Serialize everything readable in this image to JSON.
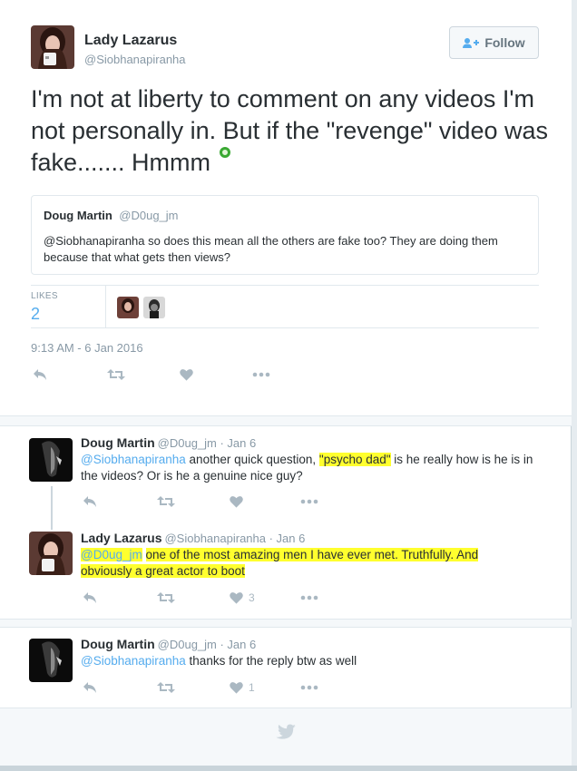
{
  "main_tweet": {
    "author_name": "Lady Lazarus",
    "author_handle": "@Siobhanapiranha",
    "follow_label": "Follow",
    "text": "I'm not at liberty to comment on any videos I'm not personally in. But if the \"revenge\" video was fake....... Hmmm",
    "quoted": {
      "author_name": "Doug Martin",
      "author_handle": "@D0ug_jm",
      "text": "@Siobhanapiranha so does this mean all the others are fake too? They are doing them because that what gets then views?"
    },
    "likes_label": "LIKES",
    "likes_count": "2",
    "timestamp": "9:13 AM - 6 Jan 2016"
  },
  "replies": [
    {
      "author_name": "Doug Martin",
      "meta": "@D0ug_jm · Jan 6",
      "mention": "@Siobhanapiranha",
      "text_before_hl": " another quick question, ",
      "highlight": "\"psycho dad\"",
      "text_after_hl": " is he really how is he is in the videos? Or is he a genuine nice guy?",
      "like_count": ""
    },
    {
      "author_name": "Lady Lazarus",
      "meta": "@Siobhanapiranha · Jan 6",
      "mention": "@D0ug_jm",
      "highlight_text": "one of the most amazing men I have ever met. Truthfully. And obviously a great actor to boot",
      "like_count": "3"
    },
    {
      "author_name": "Doug Martin",
      "meta": "@D0ug_jm · Jan 6",
      "mention": "@Siobhanapiranha",
      "text": " thanks for the reply btw as well",
      "like_count": "1"
    }
  ],
  "colors": {
    "link": "#55acee",
    "highlight": "#ffff2e",
    "action_icon": "#aab8c2"
  }
}
